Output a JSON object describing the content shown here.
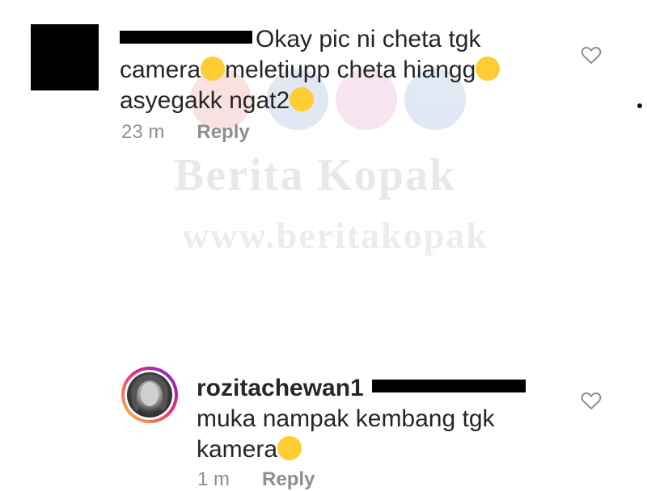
{
  "watermark": {
    "line1": "Berita Kopak",
    "line2": "www.beritakopak"
  },
  "comments": [
    {
      "username": "",
      "text_line1": "Okay pic ni cheta tgk",
      "text_line2a": "camera",
      "text_line2b": "meletiupp cheta hiangg",
      "text_line3": "asyegakk ngat2",
      "time": "23 m",
      "reply_label": "Reply"
    },
    {
      "username": "rozitachewan1",
      "text_line1": "muka nampak kembang tgk",
      "text_line2": "kamera",
      "time": "1 m",
      "reply_label": "Reply"
    }
  ],
  "icons": {
    "like": "heart-outline-icon",
    "emoji_sweat": "grinning-sweat-emoji",
    "emoji_hearts": "heart-eyes-emoji",
    "emoji_tongue": "winking-tongue-emoji"
  },
  "colors": {
    "text": "#262626",
    "meta": "#8e8e8e",
    "ring_start": "#f9ce34",
    "ring_mid": "#ee2a7b",
    "ring_end": "#6228d7",
    "emoji": "#ffcc33"
  }
}
